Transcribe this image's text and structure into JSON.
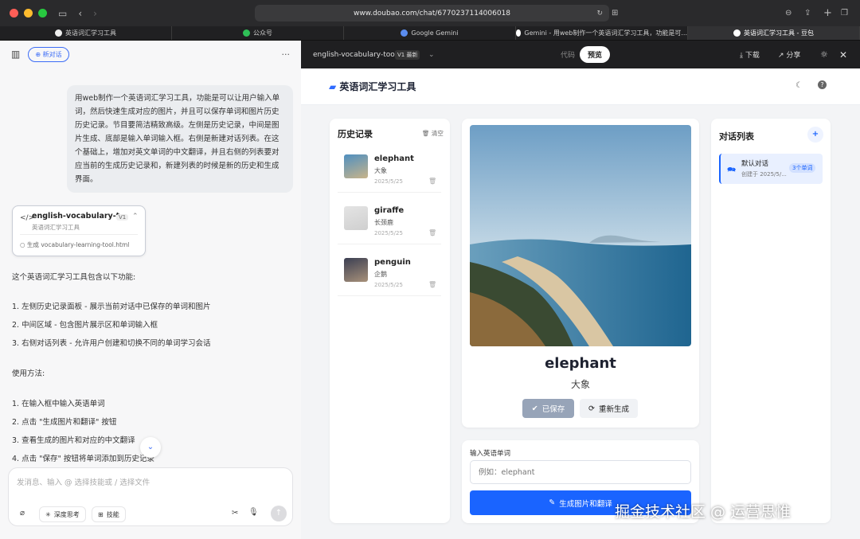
{
  "browser": {
    "url": "www.doubao.com/chat/6770237114006018",
    "tabs": [
      {
        "label": "英语词汇学习工具",
        "color": "#eeeeee",
        "active": false
      },
      {
        "label": "公众号",
        "color": "#2fbf57",
        "active": false
      },
      {
        "label": "Google Gemini",
        "color": "#5b8def",
        "active": false
      },
      {
        "label": "Gemini - 用web制作一个英语词汇学习工具，功能是可...",
        "color": "#ffffff",
        "active": false
      },
      {
        "label": "英语词汇学习工具 - 豆包",
        "color": "#ffffff",
        "active": true
      }
    ]
  },
  "left": {
    "new_chat": "新对话",
    "more": "···",
    "prompt": "用web制作一个英语词汇学习工具，功能是可以让用户输入单词，然后快速生成对应的图片，并且可以保存单词和图片历史历史记录。节目要简洁精致高级。左侧是历史记录，中间是图片生成、底部是输入单词输入框。右侧是新建对话列表。在这个基础上，增加对英文单词的中文翻译，并且右侧的列表要对应当前的生成历史记录和，新建列表的时候是新的历史和生成界面。",
    "artifact": {
      "title": "english-vocabulary-t...",
      "subtitle": "英语词汇学习工具",
      "version": "V1",
      "file": "生成 vocabulary-learning-tool.html"
    },
    "intro": "这个英语词汇学习工具包含以下功能:",
    "features": [
      "1.   左侧历史记录面板 - 展示当前对话中已保存的单词和图片",
      "2.   中间区域 - 包含图片展示区和单词输入框",
      "3.   右侧对话列表 - 允许用户创建和切换不同的单词学习会话"
    ],
    "usage_title": "使用方法:",
    "steps": [
      "1.   在输入框中输入英语单词",
      "2.   点击 \"生成图片和翻译\" 按钮",
      "3.   查看生成的图片和对应的中文翻译",
      "4.   点击 \"保存\" 按钮将单词添加到历史记录"
    ],
    "input_placeholder": "发消息、输入 @ 选择技能或 / 选择文件",
    "chip_think": "深度思考",
    "chip_skill": "技能"
  },
  "right": {
    "file_name": "english-vocabulary-tool",
    "version": "V1",
    "version_badge": "最新",
    "tab_code": "代码",
    "tab_preview": "预览",
    "download": "下载",
    "share": "分享",
    "app_title": "英语词汇学习工具",
    "history_title": "历史记录",
    "clear": "清空",
    "history": [
      {
        "word": "elephant",
        "zh": "大象",
        "date": "2025/5/25",
        "c1": "#4f8fc0",
        "c2": "#c8b48a"
      },
      {
        "word": "giraffe",
        "zh": "长颈鹿",
        "date": "2025/5/25",
        "c1": "#e4e4e4",
        "c2": "#cfcfcf"
      },
      {
        "word": "penguin",
        "zh": "企鹅",
        "date": "2025/5/25",
        "c1": "#3b3f52",
        "c2": "#a8917a"
      }
    ],
    "word": "elephant",
    "translation": "大象",
    "saved_btn": "已保存",
    "regen_btn": "重新生成",
    "input_label": "输入英语单词",
    "input_placeholder": "例如：elephant",
    "generate_btn": "生成图片和翻译",
    "conv_title": "对话列表",
    "conv_name": "默认对话",
    "conv_created": "创建于 2025/5/...",
    "conv_count": "3个单词"
  },
  "watermark": "掘金技术社区 @ 运营思惟"
}
